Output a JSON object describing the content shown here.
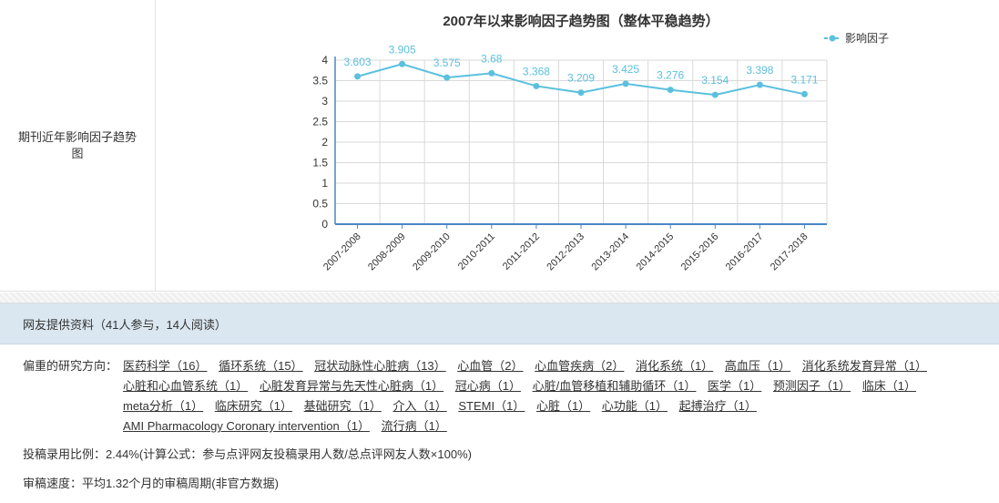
{
  "trend": {
    "label": "期刊近年影响因子趋势图"
  },
  "chart_data": {
    "type": "line",
    "title": "2007年以来影响因子趋势图（整体平稳趋势）",
    "categories": [
      "2007-2008",
      "2008-2009",
      "2009-2010",
      "2010-2011",
      "2011-2012",
      "2012-2013",
      "2013-2014",
      "2014-2015",
      "2015-2016",
      "2016-2017",
      "2017-2018"
    ],
    "series": [
      {
        "name": "影响因子",
        "values": [
          3.603,
          3.905,
          3.575,
          3.68,
          3.368,
          3.209,
          3.425,
          3.276,
          3.154,
          3.398,
          3.171
        ]
      }
    ],
    "yticks": [
      "0",
      "0.5",
      "1",
      "1.5",
      "2",
      "2.5",
      "3",
      "3.5",
      "4"
    ],
    "ylim": [
      0,
      4
    ],
    "grid": true,
    "legend": "top-right",
    "color": "#5bc0de"
  },
  "community": {
    "header": "网友提供资料（41人参与，14人阅读）"
  },
  "directions": {
    "label": "偏重的研究方向：",
    "tags": [
      "医药科学（16）",
      "循环系统（15）",
      "冠状动脉性心脏病（13）",
      "心血管（2）",
      "心血管疾病（2）",
      "消化系统（1）",
      "高血压（1）",
      "消化系统发育异常（1）",
      "心脏和心血管系统（1）",
      "心脏发育异常与先天性心脏病（1）",
      "冠心病（1）",
      "心脏/血管移植和辅助循环（1）",
      "医学（1）",
      "预测因子（1）",
      "临床（1）",
      "meta分析（1）",
      "临床研究（1）",
      "基础研究（1）",
      "介入（1）",
      "STEMI（1）",
      "心脏（1）",
      "心功能（1）",
      "起搏治疗（1）",
      "AMI Pharmacology Coronary intervention（1）",
      "流行病（1）"
    ]
  },
  "ratio": {
    "text": "投稿录用比例：2.44%(计算公式：参与点评网友投稿录用人数/总点评网友人数×100%)"
  },
  "speed": {
    "text": "审稿速度：平均1.32个月的审稿周期(非官方数据)"
  }
}
